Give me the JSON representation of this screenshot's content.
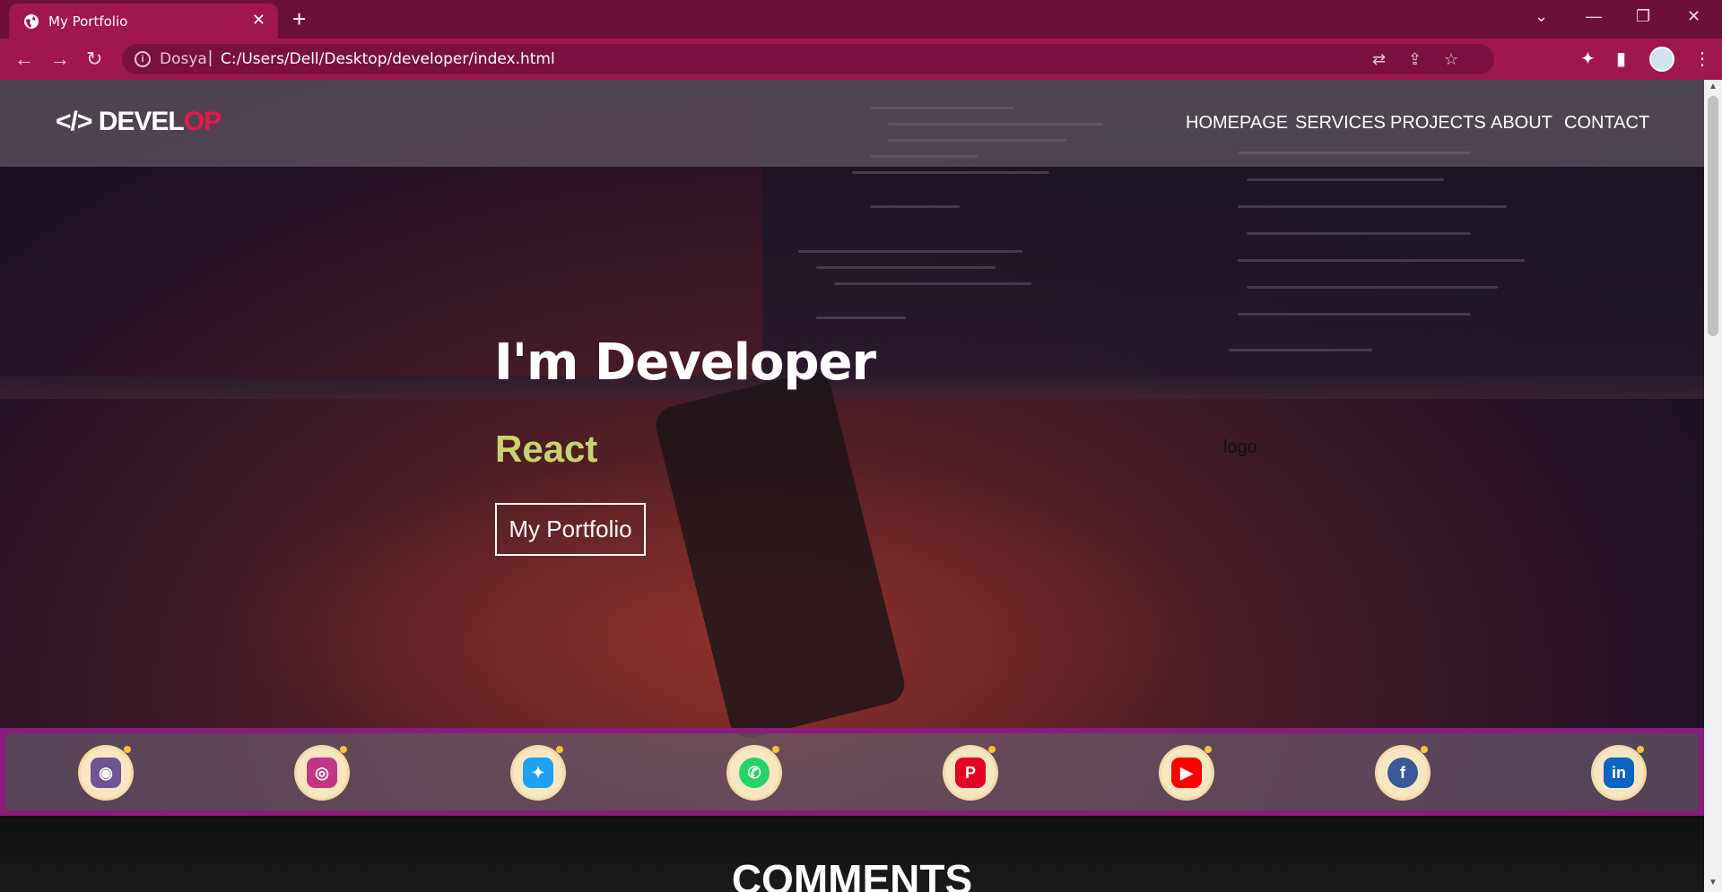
{
  "browser": {
    "tab_title": "My Portfolio",
    "tab_close": "✕",
    "new_tab": "+",
    "site_label": "Dosya",
    "url": "C:/Users/Dell/Desktop/developer/index.html"
  },
  "navbar": {
    "logo_mark": "</>",
    "logo_main": "DEVEL",
    "logo_accent": "OP",
    "links": [
      "HOMEPAGE",
      "SERVICES",
      "PROJECTS",
      "ABOUT",
      "CONTACT"
    ]
  },
  "hero": {
    "title": "I'm Developer",
    "subtitle": "React",
    "button": "My Portfolio",
    "logo_text": "logo"
  },
  "social": [
    {
      "name": "github",
      "color": "#6e5494"
    },
    {
      "name": "instagram",
      "color": "#c13584"
    },
    {
      "name": "twitter",
      "color": "#1da1f2"
    },
    {
      "name": "whatsapp",
      "color": "#25d366"
    },
    {
      "name": "pinterest",
      "color": "#e60023"
    },
    {
      "name": "youtube",
      "color": "#ff0000"
    },
    {
      "name": "facebook",
      "color": "#3b5998"
    },
    {
      "name": "linkedin",
      "color": "#0a66c2"
    }
  ],
  "comments": {
    "title": "COMMENTS"
  },
  "colors": {
    "browser_frame": "#a0164e",
    "logo_accent": "#e8174a",
    "subtitle": "#c7d46b",
    "social_border": "#8a1c7c"
  }
}
